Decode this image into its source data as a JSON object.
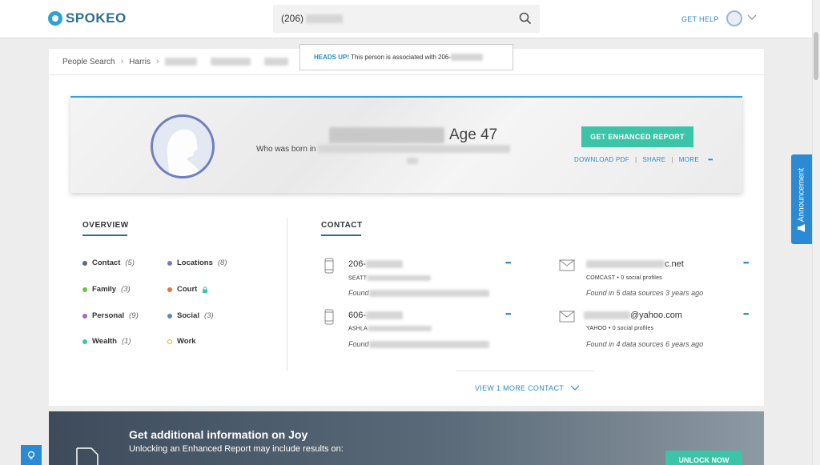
{
  "header": {
    "logo_text": "SPOKEO",
    "search_value": "(206)",
    "get_help": "GET HELP"
  },
  "breadcrumb": {
    "items": [
      "People Search",
      "Harris"
    ]
  },
  "headsup": {
    "label": "HEADS UP!",
    "text": " This person is associated with 206-"
  },
  "profile": {
    "age": "Age 47",
    "who_born": "Who was born in",
    "enhanced_button": "GET ENHANCED REPORT",
    "actions": [
      "DOWNLOAD PDF",
      "SHARE",
      "MORE"
    ],
    "more_dots": "•••"
  },
  "overview": {
    "title": "OVERVIEW",
    "items": [
      {
        "label": "Contact",
        "count": "(5)",
        "color": "#5b6b7a"
      },
      {
        "label": "Locations",
        "count": "(8)",
        "color": "#7a79c7"
      },
      {
        "label": "Family",
        "count": "(3)",
        "color": "#6cc04a"
      },
      {
        "label": "Court",
        "count": "",
        "color": "#e8752b"
      },
      {
        "label": "Personal",
        "count": "(9)",
        "color": "#a06cc8"
      },
      {
        "label": "Social",
        "count": "(3)",
        "color": "#5b8bb0"
      },
      {
        "label": "Wealth",
        "count": "(1)",
        "color": "#3cc4a8"
      },
      {
        "label": "Work",
        "count": "",
        "color": "#e8a51e"
      }
    ]
  },
  "contact": {
    "title": "CONTACT",
    "phones": [
      {
        "number": "206-",
        "location": "SEATT",
        "found": "Found"
      },
      {
        "number": "606-",
        "location": "ASHLA",
        "found": "Found"
      }
    ],
    "emails": [
      {
        "address": "c.net",
        "provider": "COMCAST • 0 social profiles",
        "found": "Found in 5 data sources 3 years ago"
      },
      {
        "address": "@yahoo.com",
        "provider": "YAHOO • 0 social profiles",
        "found": "Found in 4 data sources 6 years ago"
      }
    ],
    "dots": "•••",
    "view_more": "VIEW 1 MORE CONTACT"
  },
  "banner": {
    "title": "Get additional information on Joy",
    "subtitle": "Unlocking an Enhanced Report may include results on:",
    "unlock": "UNLOCK NOW"
  },
  "announcement": "Announcement"
}
